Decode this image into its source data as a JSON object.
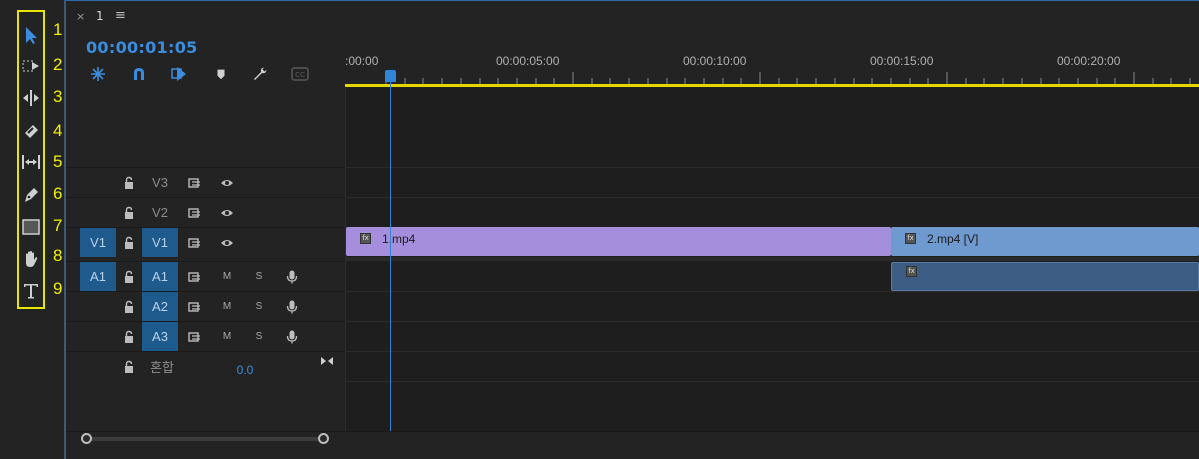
{
  "panel": {
    "tab_close": "×",
    "sequence_name": "1",
    "tab_menu": "≡",
    "timecode": "00:00:01:05"
  },
  "tools": [
    {
      "number": "1.",
      "icon": "selection-arrow-icon"
    },
    {
      "number": "2.",
      "icon": "track-select-forward-icon"
    },
    {
      "number": "3.",
      "icon": "ripple-edit-icon"
    },
    {
      "number": "4.",
      "icon": "razor-icon"
    },
    {
      "number": "5.",
      "icon": "slip-icon"
    },
    {
      "number": "6.",
      "icon": "pen-icon"
    },
    {
      "number": "7.",
      "icon": "rectangle-icon"
    },
    {
      "number": "8.",
      "icon": "hand-icon"
    },
    {
      "number": "9.",
      "icon": "type-icon"
    }
  ],
  "header_tools": [
    "nest-icon",
    "snap-icon",
    "linked-selection-icon",
    "marker-icon",
    "wrench-icon",
    "captions-icon"
  ],
  "ruler": {
    "labels": [
      ":00:00",
      "00:00:05:00",
      "00:00:10:00",
      "00:00:15:00",
      "00:00:20:00"
    ]
  },
  "tracks": {
    "v3": {
      "label": "V3"
    },
    "v2": {
      "label": "V2"
    },
    "v1": {
      "source": "V1",
      "label": "V1"
    },
    "a1": {
      "source": "A1",
      "label": "A1",
      "mute": "M",
      "solo": "S"
    },
    "a2": {
      "label": "A2",
      "mute": "M",
      "solo": "S"
    },
    "a3": {
      "label": "A3",
      "mute": "M",
      "solo": "S"
    },
    "mix": {
      "label": "혼합",
      "value": "0.0"
    }
  },
  "clips": {
    "clip1": {
      "label": "1.mp4",
      "color": "#a58fdc"
    },
    "clip2": {
      "label": "2.mp4 [V]",
      "color": "#6f9ad0"
    },
    "clip2_audio": {
      "color": "#3d5c84"
    }
  },
  "colors": {
    "accent": "#2f86d8",
    "annotation": "#f0f000"
  }
}
